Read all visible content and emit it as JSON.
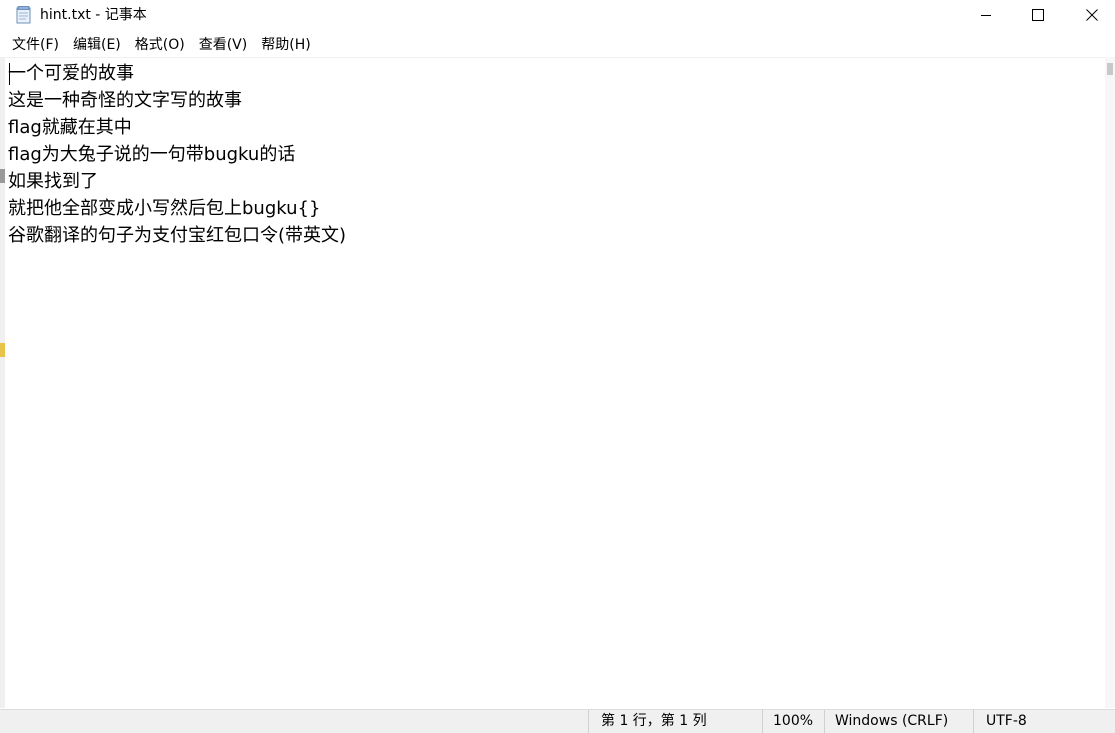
{
  "window": {
    "title": "hint.txt - 记事本",
    "icon": "notepad-icon"
  },
  "controls": {
    "minimize_icon": "minimize-icon",
    "maximize_icon": "maximize-icon",
    "close_icon": "close-icon"
  },
  "menu": [
    {
      "label": "文件(F)"
    },
    {
      "label": "编辑(E)"
    },
    {
      "label": "格式(O)"
    },
    {
      "label": "查看(V)"
    },
    {
      "label": "帮助(H)"
    }
  ],
  "editor": {
    "lines": [
      "一个可爱的故事",
      "这是一种奇怪的文字写的故事",
      "flag就藏在其中",
      "flag为大兔子说的一句带bugku的话",
      "如果找到了",
      "就把他全部变成小写然后包上bugku{}",
      "谷歌翻译的句子为支付宝红包口令(带英文)"
    ]
  },
  "status": {
    "position": "第 1 行，第 1 列",
    "zoom": "100%",
    "line_ending": "Windows (CRLF)",
    "encoding": "UTF-8"
  }
}
